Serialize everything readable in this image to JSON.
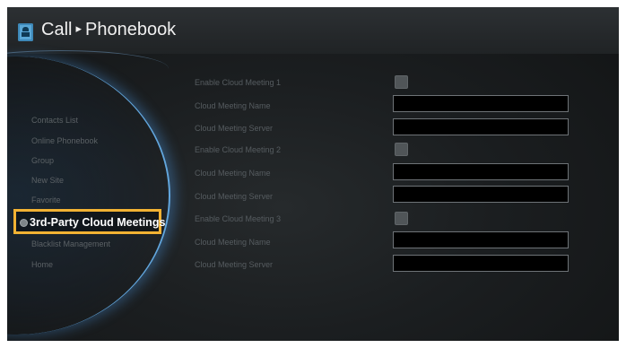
{
  "header": {
    "title_part1": "Call",
    "arrow": "▸",
    "title_part2": "Phonebook",
    "icon": "phonebook-icon"
  },
  "menu": {
    "items": [
      {
        "label": "Contacts List"
      },
      {
        "label": "Online Phonebook"
      },
      {
        "label": "Group"
      },
      {
        "label": "New Site"
      },
      {
        "label": "Favorite"
      },
      {
        "label": "3rd-Party Cloud Meetings",
        "selected": true
      },
      {
        "label": "Blacklist Management"
      },
      {
        "label": "Home"
      }
    ]
  },
  "form": {
    "meetings": [
      {
        "enable_label": "Enable Cloud Meeting 1",
        "name_label": "Cloud Meeting Name",
        "server_label": "Cloud Meeting Server",
        "enabled": false,
        "name_value": "",
        "server_value": ""
      },
      {
        "enable_label": "Enable Cloud Meeting 2",
        "name_label": "Cloud Meeting Name",
        "server_label": "Cloud Meeting Server",
        "enabled": false,
        "name_value": "",
        "server_value": ""
      },
      {
        "enable_label": "Enable Cloud Meeting 3",
        "name_label": "Cloud Meeting Name",
        "server_label": "Cloud Meeting Server",
        "enabled": false,
        "name_value": "",
        "server_value": ""
      }
    ]
  },
  "colors": {
    "highlight": "#f2b233",
    "orb_edge": "#6ebeff",
    "background": "#1b1e20"
  }
}
